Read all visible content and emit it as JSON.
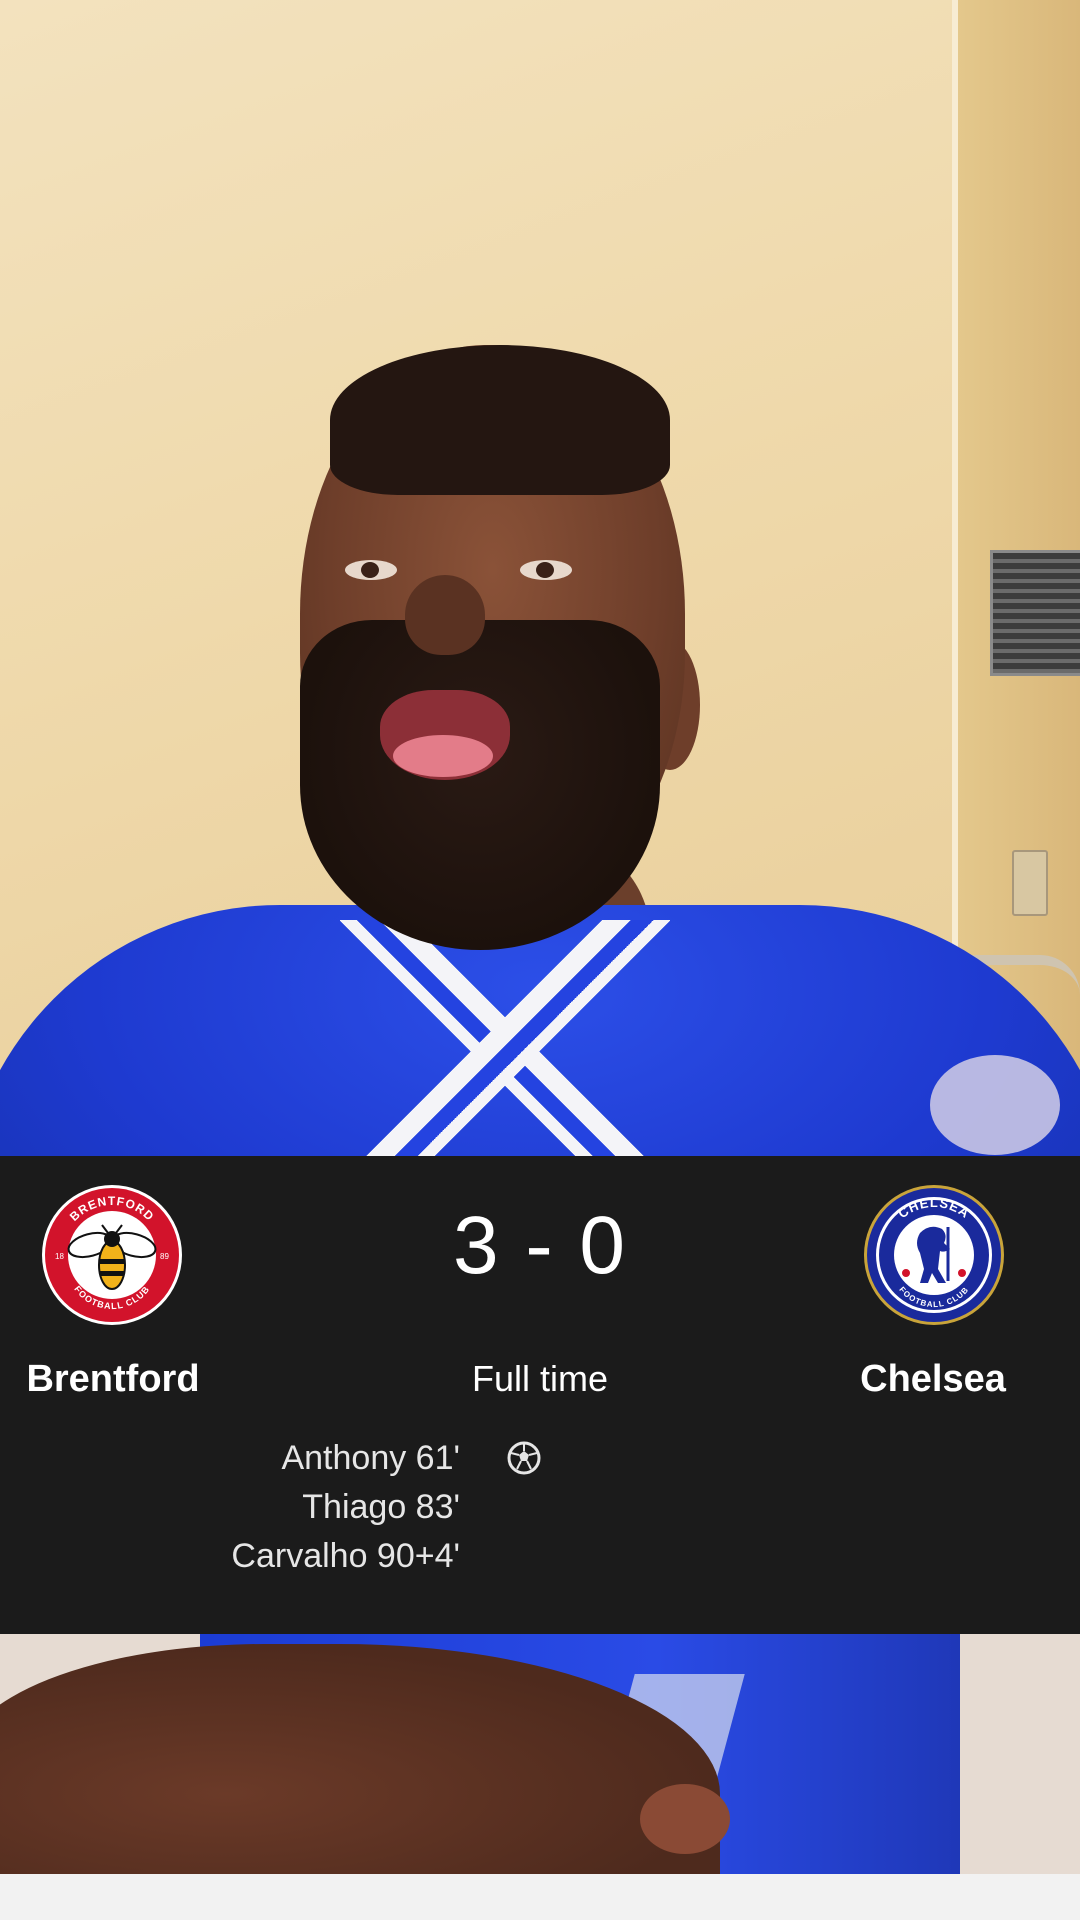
{
  "match": {
    "home_team": "Brentford",
    "away_team": "Chelsea",
    "score": "3 - 0",
    "status": "Full time",
    "home_scorers": [
      "Anthony 61'",
      "Thiago 83'",
      "Carvalho 90+4'"
    ],
    "home_crest": {
      "ring_text_top": "BRENTFORD",
      "ring_text_bottom": "FOOTBALL CLUB",
      "year_left": "18",
      "year_right": "89",
      "color": "#d2132b"
    },
    "away_crest": {
      "ring_text_top": "CHELSEA",
      "ring_text_bottom": "FOOTBALL CLUB",
      "color": "#1a2a9c"
    },
    "goal_icon": "soccer-ball-icon"
  }
}
